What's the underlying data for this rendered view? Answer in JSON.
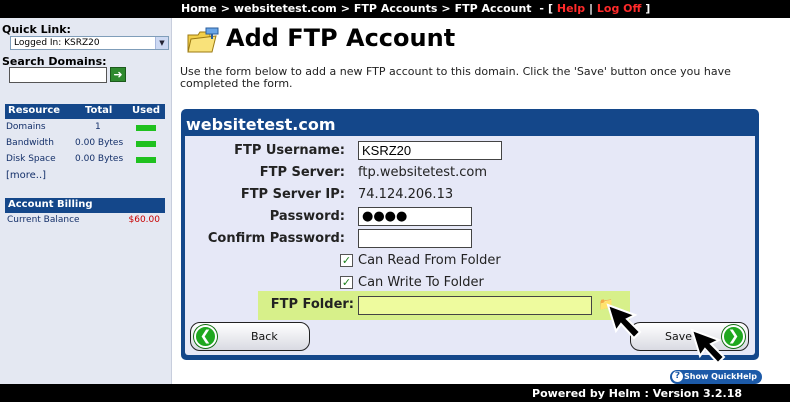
{
  "breadcrumb": {
    "items": [
      "Home",
      "websitetest.com",
      "FTP Accounts",
      "FTP Account"
    ],
    "bracket_open": "[",
    "help": "Help",
    "pipe": "|",
    "logoff": "Log Off",
    "bracket_close": "]"
  },
  "sidebar": {
    "quick_link_label": "Quick Link:",
    "quick_link_value": "Logged In: KSRZ20",
    "search_label": "Search Domains:",
    "search_value": "",
    "resource_table": {
      "headers": [
        "Resource",
        "Total",
        "Used"
      ],
      "rows": [
        {
          "resource": "Domains",
          "total": "1",
          "used_fraction": 1.0
        },
        {
          "resource": "Bandwidth",
          "total": "0.00 Bytes",
          "used_fraction": 1.0
        },
        {
          "resource": "Disk Space",
          "total": "0.00 Bytes",
          "used_fraction": 1.0
        }
      ],
      "more": "[more..]"
    },
    "billing": {
      "header": "Account Billing",
      "label": "Current Balance",
      "amount": "$60.00"
    }
  },
  "main": {
    "title": "Add FTP Account",
    "intro": "Use the form below to add a new FTP account to this domain. Click the 'Save' button once you have completed the form.",
    "panel_title": "websitetest.com",
    "form": {
      "username_label": "FTP Username:",
      "username_value": "KSRZ20",
      "server_label": "FTP Server:",
      "server_value": "ftp.websitetest.com",
      "server_ip_label": "FTP Server IP:",
      "server_ip_value": "74.124.206.13",
      "password_label": "Password:",
      "password_value": "●●●●",
      "confirm_label": "Confirm Password:",
      "confirm_value": "",
      "read_label": "Can Read From Folder",
      "read_checked": true,
      "write_label": "Can Write To Folder",
      "write_checked": true,
      "folder_label": "FTP Folder:",
      "folder_value": ""
    },
    "back_label": "Back",
    "save_label": "Save",
    "quickhelp_label": "Show QuickHelp"
  },
  "footer": {
    "text": "Powered by Helm  :  Version 3.2.18"
  },
  "colors": {
    "accent": "#14478a",
    "highlight": "#d7f08a",
    "used_bar": "#1fc11f",
    "link_red": "#ff2a2a"
  }
}
